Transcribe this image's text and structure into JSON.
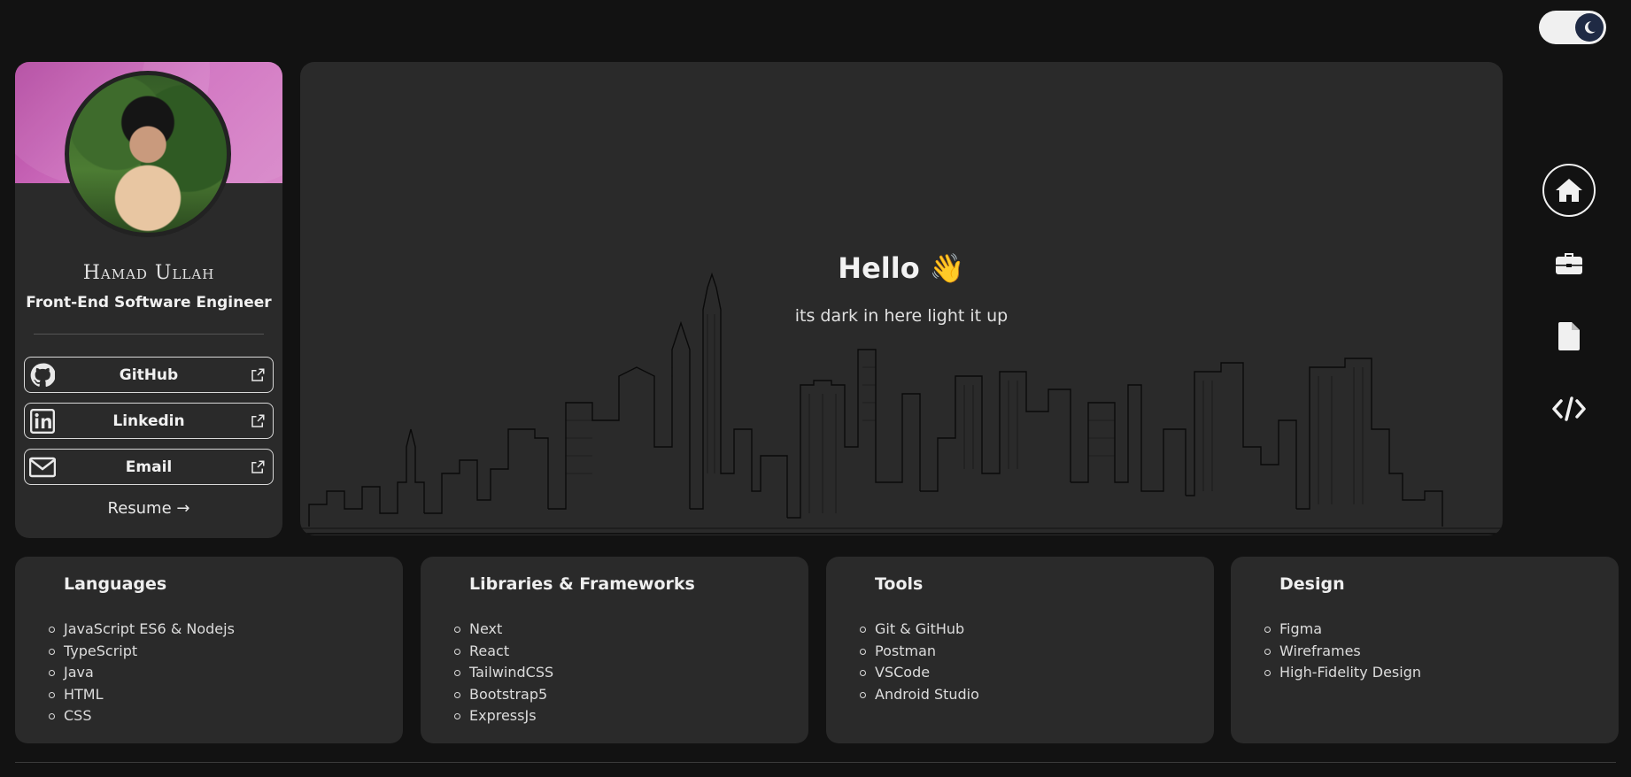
{
  "theme_toggle": {
    "icon": "moon-icon",
    "mode": "dark"
  },
  "profile": {
    "name": "Hamad Ullah",
    "title": "Front-End Software Engineer",
    "links": [
      {
        "label": "GitHub",
        "icon": "github-icon"
      },
      {
        "label": "Linkedin",
        "icon": "linkedin-icon"
      },
      {
        "label": "Email",
        "icon": "email-icon"
      }
    ],
    "resume_label": "Resume →",
    "banner_color": "#c35cb0"
  },
  "hero": {
    "greeting": "Hello 👋",
    "subtitle": "its dark in here light it up"
  },
  "nav": [
    {
      "icon": "home-icon",
      "active": true
    },
    {
      "icon": "briefcase-icon",
      "active": false
    },
    {
      "icon": "document-icon",
      "active": false
    },
    {
      "icon": "code-icon",
      "active": false
    }
  ],
  "skills": [
    {
      "title": "Languages",
      "items": [
        "JavaScript ES6 & Nodejs",
        "TypeScript",
        "Java",
        "HTML",
        "CSS"
      ]
    },
    {
      "title": "Libraries & Frameworks",
      "items": [
        "Next",
        "React",
        "TailwindCSS",
        "Bootstrap5",
        "ExpressJs"
      ]
    },
    {
      "title": "Tools",
      "items": [
        "Git & GitHub",
        "Postman",
        "VSCode",
        "Android Studio"
      ]
    },
    {
      "title": "Design",
      "items": [
        "Figma",
        "Wireframes",
        "High-Fidelity Design"
      ]
    }
  ]
}
